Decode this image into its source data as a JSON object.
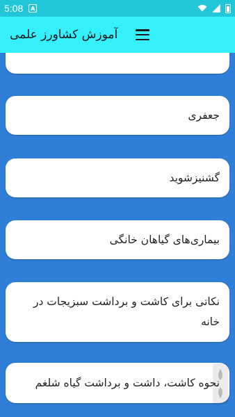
{
  "status": {
    "time": "5:08",
    "notif_letter": "A"
  },
  "appbar": {
    "title": "آموزش کشاورز علمی",
    "menu_icon": "menu-icon"
  },
  "items": [
    {
      "label": ""
    },
    {
      "label": "جعفری"
    },
    {
      "label": "گشنیزشوید"
    },
    {
      "label": "بیماری‌های گیاهان خانگی"
    },
    {
      "label": "نکاتی برای کاشت و برداشت سبزیجات در خانه"
    },
    {
      "label": "نحوه کاشت، داشت و برداشت گیاه شلغم"
    }
  ],
  "colors": {
    "statusbar": "#21c6d8",
    "appbar": "#35f0fb",
    "background": "#2f7fd8",
    "card": "#ffffff"
  }
}
